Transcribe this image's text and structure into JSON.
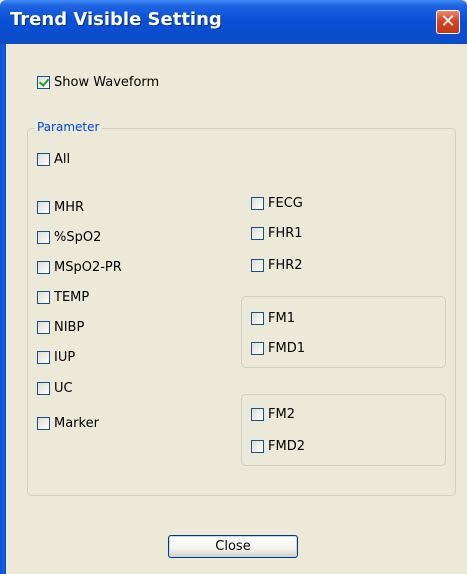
{
  "window": {
    "title": "Trend Visible Setting",
    "close_glyph": "✕"
  },
  "show_waveform": {
    "label": "Show Waveform",
    "checked": true
  },
  "parameter_group": {
    "legend": "Parameter",
    "all": {
      "label": "All",
      "checked": false
    },
    "left_items": [
      {
        "label": "MHR",
        "checked": false
      },
      {
        "label": "%SpO2",
        "checked": false
      },
      {
        "label": "MSpO2-PR",
        "checked": false
      },
      {
        "label": "TEMP",
        "checked": false
      },
      {
        "label": "NIBP",
        "checked": false
      },
      {
        "label": "IUP",
        "checked": false
      },
      {
        "label": "UC",
        "checked": false
      },
      {
        "label": "Marker",
        "checked": false
      }
    ],
    "right_items": [
      {
        "label": "FECG",
        "checked": false
      },
      {
        "label": "FHR1",
        "checked": false
      },
      {
        "label": "FHR2",
        "checked": false
      }
    ],
    "fm_group_1": [
      {
        "label": "FM1",
        "checked": false
      },
      {
        "label": "FMD1",
        "checked": false
      }
    ],
    "fm_group_2": [
      {
        "label": "FM2",
        "checked": false
      },
      {
        "label": "FMD2",
        "checked": false
      }
    ]
  },
  "buttons": {
    "close_label": "Close"
  },
  "colors": {
    "title_bar": "#0a50d8",
    "legend_text": "#0046d5",
    "check_mark": "#21a121"
  }
}
